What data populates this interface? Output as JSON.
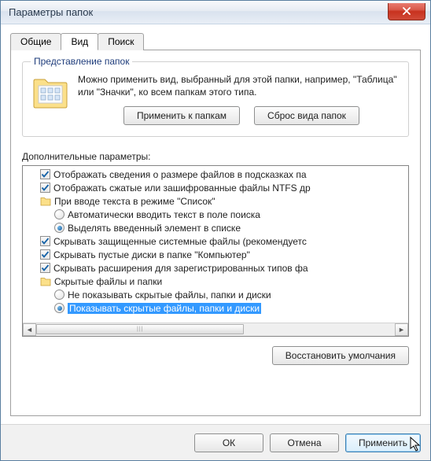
{
  "window": {
    "title": "Параметры папок"
  },
  "tabs": {
    "general": "Общие",
    "view": "Вид",
    "search": "Поиск"
  },
  "folder_view": {
    "legend": "Представление папок",
    "desc": "Можно применить вид, выбранный для этой папки, например, \"Таблица\" или \"Значки\", ко всем папкам этого типа.",
    "apply_btn": "Применить к папкам",
    "reset_btn": "Сброс вида папок"
  },
  "advanced": {
    "label": "Дополнительные параметры:",
    "items": [
      {
        "type": "check",
        "level": 1,
        "checked": true,
        "label": "Отображать сведения о размере файлов в подсказках па"
      },
      {
        "type": "check",
        "level": 1,
        "checked": true,
        "label": "Отображать сжатые или зашифрованные файлы NTFS др"
      },
      {
        "type": "group",
        "level": 1,
        "label": "При вводе текста в режиме \"Список\""
      },
      {
        "type": "radio",
        "level": 2,
        "checked": false,
        "label": "Автоматически вводить текст в поле поиска"
      },
      {
        "type": "radio",
        "level": 2,
        "checked": true,
        "label": "Выделять введенный элемент в списке"
      },
      {
        "type": "check",
        "level": 1,
        "checked": true,
        "label": "Скрывать защищенные системные файлы (рекомендуетс"
      },
      {
        "type": "check",
        "level": 1,
        "checked": true,
        "label": "Скрывать пустые диски в папке \"Компьютер\""
      },
      {
        "type": "check",
        "level": 1,
        "checked": true,
        "label": "Скрывать расширения для зарегистрированных типов фа"
      },
      {
        "type": "group",
        "level": 1,
        "label": "Скрытые файлы и папки"
      },
      {
        "type": "radio",
        "level": 2,
        "checked": false,
        "label": "Не показывать скрытые файлы, папки и диски"
      },
      {
        "type": "radio",
        "level": 2,
        "checked": true,
        "label": "Показывать скрытые файлы, папки и диски",
        "selected": true
      }
    ],
    "restore_btn": "Восстановить умолчания"
  },
  "footer": {
    "ok": "ОК",
    "cancel": "Отмена",
    "apply": "Применить"
  }
}
